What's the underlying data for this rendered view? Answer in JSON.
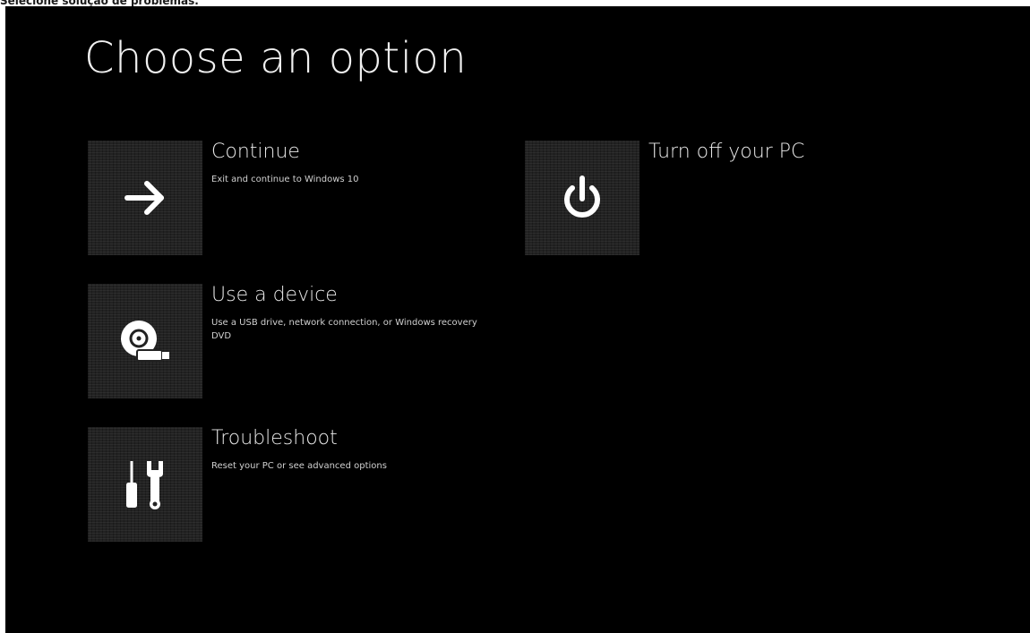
{
  "caption": "Selecione solução de problemas.",
  "screen": {
    "title": "Choose an option",
    "background": "#000000",
    "options": [
      {
        "title": "Continue",
        "description": "Exit and continue to Windows 10",
        "icon": "arrow-right-icon"
      },
      {
        "title": "Turn off your PC",
        "description": "",
        "icon": "power-icon"
      },
      {
        "title": "Use a device",
        "description": "Use a USB drive, network connection, or Windows recovery DVD",
        "icon": "disc-usb-icon"
      },
      {
        "title": "Troubleshoot",
        "description": "Reset your PC or see advanced options",
        "icon": "tools-icon"
      }
    ]
  }
}
